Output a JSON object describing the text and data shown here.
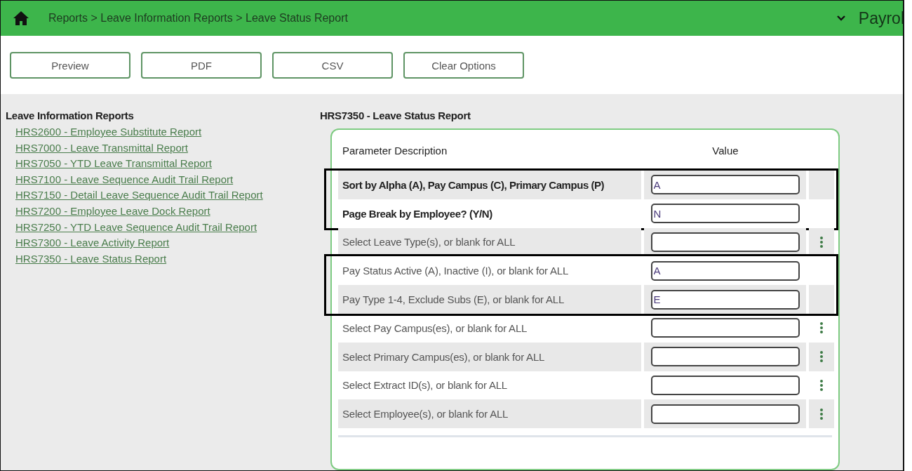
{
  "header": {
    "breadcrumb": "Reports > Leave Information Reports > Leave Status Report",
    "app_menu": "Payrol"
  },
  "toolbar": {
    "buttons": [
      "Preview",
      "PDF",
      "CSV",
      "Clear Options"
    ]
  },
  "sidebar": {
    "title": "Leave Information Reports",
    "items": [
      {
        "label": "HRS2600 - Employee Substitute Report"
      },
      {
        "label": "HRS7000 - Leave Transmittal Report"
      },
      {
        "label": "HRS7050 - YTD Leave Transmittal Report"
      },
      {
        "label": "HRS7100 - Leave Sequence Audit Trail Report"
      },
      {
        "label": "HRS7150 - Detail Leave Sequence Audit Trail Report"
      },
      {
        "label": "HRS7200 - Employee Leave Dock Report"
      },
      {
        "label": "HRS7250 - YTD Leave Sequence Audit Trail Report"
      },
      {
        "label": "HRS7300 - Leave Activity Report"
      },
      {
        "label": "HRS7350 - Leave Status Report"
      }
    ]
  },
  "report": {
    "title": "HRS7350 - Leave Status Report",
    "columns": [
      "Parameter Description",
      "Value"
    ],
    "groups": [
      {
        "highlighted": true,
        "rows": [
          {
            "description": "Sort by Alpha (A), Pay Campus (C), Primary Campus (P)",
            "value": "A",
            "emphasis": true,
            "has_menu": false
          },
          {
            "description": "Page Break by Employee? (Y/N)",
            "value": "N",
            "emphasis": true,
            "has_menu": false
          }
        ]
      },
      {
        "highlighted": false,
        "rows": [
          {
            "description": "Select Leave Type(s), or blank for ALL",
            "emphasis": false,
            "has_menu": true
          }
        ]
      },
      {
        "highlighted": true,
        "rows": [
          {
            "description": "Pay Status Active (A), Inactive (I), or blank for ALL",
            "value": "A",
            "emphasis": false,
            "has_menu": false
          },
          {
            "description": "Pay Type 1-4, Exclude Subs (E), or blank for ALL",
            "value": "E",
            "emphasis": false,
            "has_menu": false
          }
        ]
      },
      {
        "highlighted": false,
        "rows": [
          {
            "description": "Select Pay Campus(es), or blank for ALL",
            "emphasis": false,
            "has_menu": true
          },
          {
            "description": "Select Primary Campus(es), or blank for ALL",
            "emphasis": false,
            "has_menu": true
          },
          {
            "description": "Select Extract ID(s), or blank for ALL",
            "emphasis": false,
            "has_menu": true
          },
          {
            "description": "Select Employee(s), or blank for ALL",
            "emphasis": false,
            "has_menu": true
          }
        ]
      }
    ]
  }
}
